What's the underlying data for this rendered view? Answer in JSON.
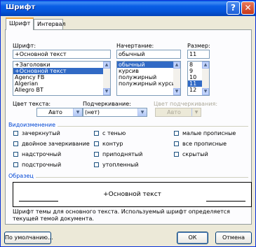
{
  "window": {
    "title": "Шрифт",
    "help_label": "?",
    "close_label": "✕"
  },
  "tabs": [
    {
      "label": "Шрифт",
      "active": true
    },
    {
      "label": "Интервал",
      "active": false
    }
  ],
  "font": {
    "label": "Шрифт:",
    "value": "+Основной текст",
    "items": [
      "+Заголовки",
      "+Основной текст",
      "Agency FB",
      "Algerian",
      "Allegro BT"
    ],
    "selected_index": 1
  },
  "style": {
    "label": "Начертание:",
    "value": "обычный",
    "items": [
      "обычный",
      "курсив",
      "полужирный",
      "полужирный курсив"
    ],
    "selected_index": 0
  },
  "size": {
    "label": "Размер:",
    "value": "11",
    "items": [
      "8",
      "9",
      "10",
      "11",
      "12"
    ],
    "selected_index": 3
  },
  "font_color": {
    "label": "Цвет текста:",
    "value": "Авто"
  },
  "underline": {
    "label": "Подчеркивание:",
    "value": "(нет)"
  },
  "underline_color": {
    "label": "Цвет подчеркивания:",
    "value": "Авто"
  },
  "effects": {
    "title": "Видоизменение",
    "items": [
      {
        "label": "зачеркнутый",
        "checked": false
      },
      {
        "label": "двойное зачеркивание",
        "checked": false
      },
      {
        "label": "надстрочный",
        "checked": false
      },
      {
        "label": "подстрочный",
        "checked": false
      },
      {
        "label": "с тенью",
        "checked": false
      },
      {
        "label": "контур",
        "checked": false
      },
      {
        "label": "приподнятый",
        "checked": false
      },
      {
        "label": "утопленный",
        "checked": false
      },
      {
        "label": "малые прописные",
        "checked": false
      },
      {
        "label": "все прописные",
        "checked": false
      },
      {
        "label": "скрытый",
        "checked": false
      }
    ]
  },
  "preview": {
    "title": "Образец",
    "text": "+Основной текст"
  },
  "note": "Шрифт темы для основного текста. Используемый шрифт определяется текущей темой документа.",
  "buttons": {
    "default": "По умолчанию...",
    "ok": "ОК",
    "cancel": "Отмена"
  },
  "icons": {
    "help": "help-icon",
    "close": "close-icon",
    "dropdown": "chevron-down-icon",
    "scroll_up": "scroll-up-icon",
    "scroll_down": "scroll-down-icon"
  }
}
